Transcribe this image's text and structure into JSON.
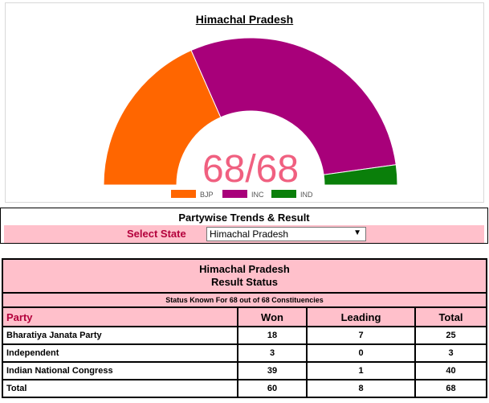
{
  "chart_data": {
    "type": "pie",
    "variant": "semi-donut",
    "title": "Himachal Pradesh",
    "center_label": "68/68",
    "categories": [
      "BJP",
      "INC",
      "IND"
    ],
    "values": [
      25,
      40,
      3
    ],
    "colors": [
      "#ff6600",
      "#a8007a",
      "#0a7f0a"
    ],
    "center_color": "#f06080",
    "legend_position": "bottom"
  },
  "selector": {
    "title": "Partywise Trends & Result",
    "label": "Select State",
    "value": "Himachal Pradesh"
  },
  "results": {
    "state": "Himachal Pradesh",
    "heading": "Result Status",
    "status_text": "Status Known For 68 out of 68 Constituencies",
    "columns": [
      "Party",
      "Won",
      "Leading",
      "Total"
    ],
    "rows": [
      {
        "party": "Bharatiya Janata Party",
        "won": "18",
        "leading": "7",
        "total": "25"
      },
      {
        "party": "Independent",
        "won": "3",
        "leading": "0",
        "total": "3"
      },
      {
        "party": "Indian National Congress",
        "won": "39",
        "leading": "1",
        "total": "40"
      },
      {
        "party": "Total",
        "won": "60",
        "leading": "8",
        "total": "68"
      }
    ]
  }
}
